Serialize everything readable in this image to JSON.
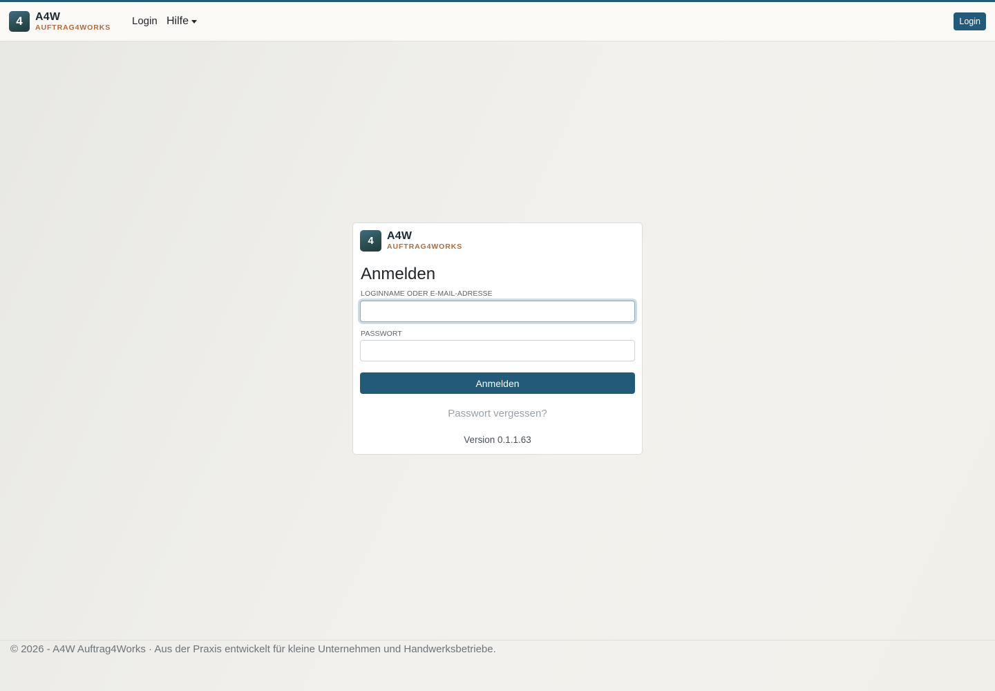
{
  "brand": {
    "logo_char": "4",
    "title": "A4W",
    "subtitle": "AUFTRAG4WORKS"
  },
  "nav": {
    "login_label": "Login",
    "help_label": "Hilfe",
    "login_button": "Login"
  },
  "login_card": {
    "heading": "Anmelden",
    "username_label": "LOGINNAME ODER E-MAIL-ADRESSE",
    "username_value": "",
    "password_label": "PASSWORT",
    "password_value": "",
    "submit_label": "Anmelden",
    "forgot_label": "Passwort vergessen?",
    "version": "Version 0.1.1.63"
  },
  "footer": {
    "text": "© 2026 - A4W Auftrag4Works · Aus der Praxis entwickelt für kleine Unternehmen und Handwerksbetriebe."
  },
  "colors": {
    "primary": "#235a7a",
    "brand_sub": "#b26a3e"
  }
}
